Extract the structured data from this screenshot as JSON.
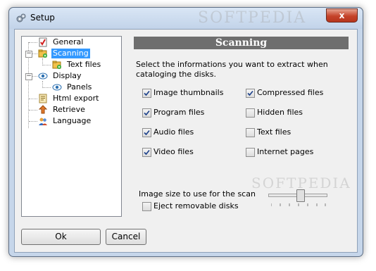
{
  "window": {
    "title": "Setup",
    "close_label": "x"
  },
  "tree": {
    "items": [
      {
        "label": "General",
        "icon": "general-icon"
      },
      {
        "label": "Scanning",
        "icon": "scanning-icon",
        "selected": true
      },
      {
        "label": "Text files",
        "icon": "text-files-icon"
      },
      {
        "label": "Display",
        "icon": "display-eye-icon"
      },
      {
        "label": "Panels",
        "icon": "panels-eye-icon"
      },
      {
        "label": "Html export",
        "icon": "html-export-icon"
      },
      {
        "label": "Retrieve",
        "icon": "retrieve-icon"
      },
      {
        "label": "Language",
        "icon": "language-icon"
      }
    ]
  },
  "panel": {
    "header": "Scanning",
    "description": "Select the informations you want to extract when cataloging the disks.",
    "checkboxes": [
      {
        "label": "Image thumbnails",
        "checked": true
      },
      {
        "label": "Compressed files",
        "checked": true
      },
      {
        "label": "Program files",
        "checked": true
      },
      {
        "label": "Hidden files",
        "checked": false
      },
      {
        "label": "Audio files",
        "checked": true
      },
      {
        "label": "Text files",
        "checked": false
      },
      {
        "label": "Video files",
        "checked": true
      },
      {
        "label": "Internet pages",
        "checked": false
      }
    ],
    "image_size_label": "Image size to use for the scan",
    "eject_label": "Eject removable disks",
    "eject_checked": false
  },
  "buttons": {
    "ok": "Ok",
    "cancel": "Cancel"
  },
  "watermarks": {
    "top": "SOFTPEDIA",
    "side": "SOFTPEDIA"
  },
  "colors": {
    "selection": "#3399ff",
    "header_bg": "#6e6e6e",
    "close_red": "#c5432a"
  }
}
